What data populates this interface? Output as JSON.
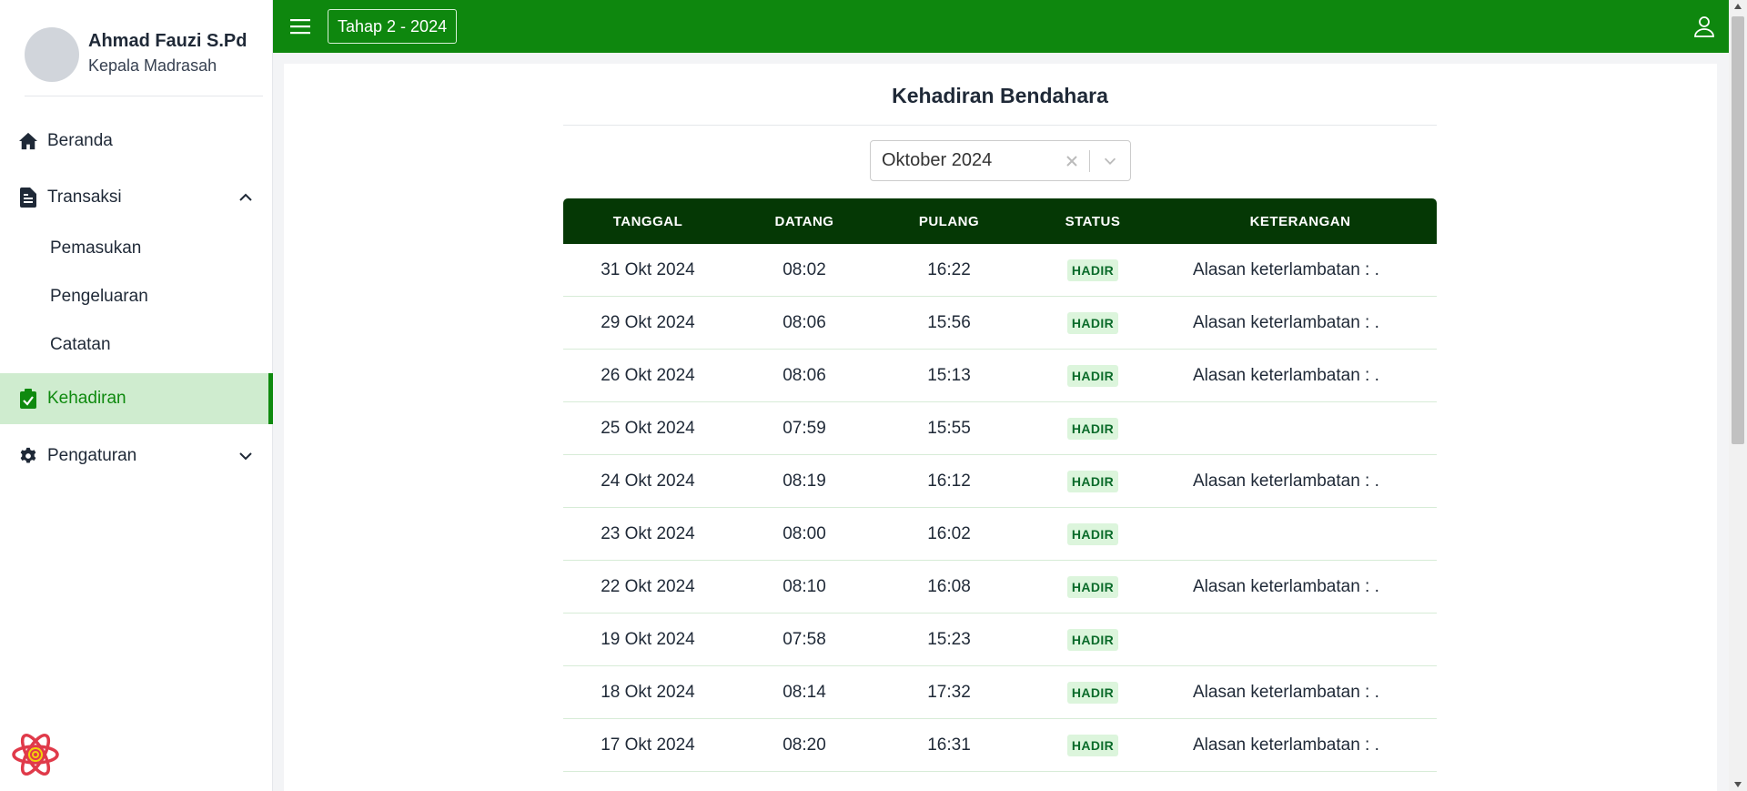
{
  "profile": {
    "name": "Ahmad Fauzi S.Pd",
    "role": "Kepala Madrasah"
  },
  "sidebar": {
    "items": [
      {
        "label": "Beranda",
        "icon": "home-icon"
      },
      {
        "label": "Transaksi",
        "icon": "document-icon",
        "expanded": true,
        "children": [
          {
            "label": "Pemasukan"
          },
          {
            "label": "Pengeluaran"
          },
          {
            "label": "Catatan"
          }
        ]
      },
      {
        "label": "Kehadiran",
        "icon": "clipboard-check-icon",
        "active": true
      },
      {
        "label": "Pengaturan",
        "icon": "gear-icon",
        "expanded": false
      }
    ]
  },
  "topbar": {
    "period_button": "Tahap 2 - 2024"
  },
  "page": {
    "title": "Kehadiran Bendahara"
  },
  "month_select": {
    "value": "Oktober 2024"
  },
  "table": {
    "headers": [
      "TANGGAL",
      "DATANG",
      "PULANG",
      "STATUS",
      "KETERANGAN"
    ],
    "rows": [
      {
        "tanggal": "31 Okt 2024",
        "datang": "08:02",
        "pulang": "16:22",
        "status": "HADIR",
        "keterangan": "Alasan keterlambatan : ."
      },
      {
        "tanggal": "29 Okt 2024",
        "datang": "08:06",
        "pulang": "15:56",
        "status": "HADIR",
        "keterangan": "Alasan keterlambatan : ."
      },
      {
        "tanggal": "26 Okt 2024",
        "datang": "08:06",
        "pulang": "15:13",
        "status": "HADIR",
        "keterangan": "Alasan keterlambatan : ."
      },
      {
        "tanggal": "25 Okt 2024",
        "datang": "07:59",
        "pulang": "15:55",
        "status": "HADIR",
        "keterangan": ""
      },
      {
        "tanggal": "24 Okt 2024",
        "datang": "08:19",
        "pulang": "16:12",
        "status": "HADIR",
        "keterangan": "Alasan keterlambatan : ."
      },
      {
        "tanggal": "23 Okt 2024",
        "datang": "08:00",
        "pulang": "16:02",
        "status": "HADIR",
        "keterangan": ""
      },
      {
        "tanggal": "22 Okt 2024",
        "datang": "08:10",
        "pulang": "16:08",
        "status": "HADIR",
        "keterangan": "Alasan keterlambatan : ."
      },
      {
        "tanggal": "19 Okt 2024",
        "datang": "07:58",
        "pulang": "15:23",
        "status": "HADIR",
        "keterangan": ""
      },
      {
        "tanggal": "18 Okt 2024",
        "datang": "08:14",
        "pulang": "17:32",
        "status": "HADIR",
        "keterangan": "Alasan keterlambatan : ."
      },
      {
        "tanggal": "17 Okt 2024",
        "datang": "08:20",
        "pulang": "16:31",
        "status": "HADIR",
        "keterangan": "Alasan keterlambatan : ."
      }
    ]
  },
  "colors": {
    "primary": "#0e870e",
    "table_header": "#053805",
    "active_bg": "#cfeccf",
    "badge_bg": "#dcf5dc",
    "badge_text": "#0b6b2a"
  }
}
